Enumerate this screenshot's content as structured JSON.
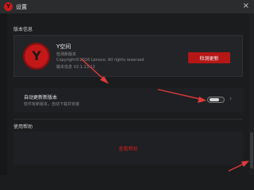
{
  "window": {
    "title": "设置",
    "logo_letter": "Y",
    "close_glyph": "×"
  },
  "version_info": {
    "section_label": "版本信息",
    "logo_letter": "Y",
    "product_name": "Y空间",
    "lines": [
      "检测新版本",
      "Copyright©2016 Lenovo. All rights reserved",
      "版本信息 V2.1.13.12"
    ],
    "check_button": "检测更新"
  },
  "auto_update": {
    "title": "自动更新新版本",
    "description": "软件有新版本，自动下载并安装",
    "help_mark": "?",
    "enabled": false
  },
  "help": {
    "section_label": "使用帮助",
    "link_label": "查看帮助"
  },
  "colors": {
    "accent": "#b51717",
    "background": "#1b1c1e",
    "annotation_arrow": "#e03a3a"
  }
}
